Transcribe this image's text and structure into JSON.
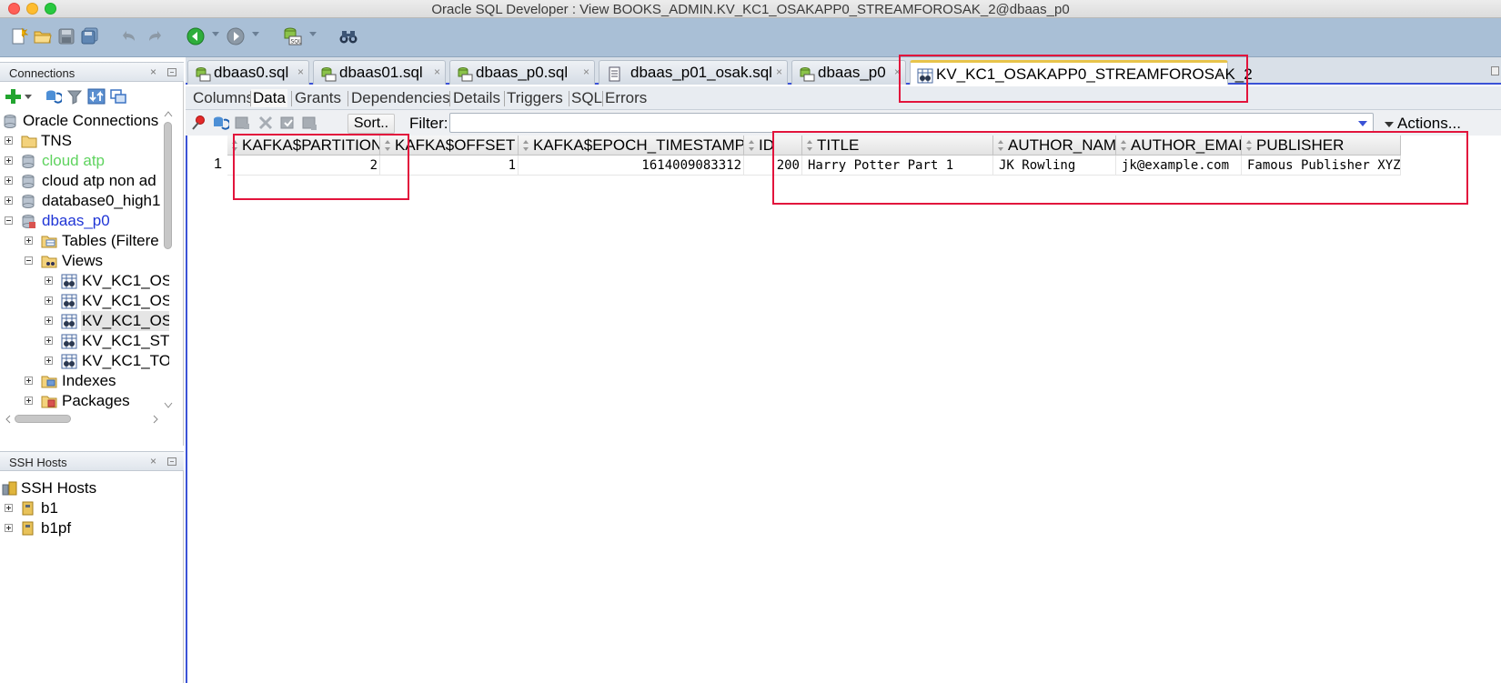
{
  "window": {
    "title": "Oracle SQL Developer : View BOOKS_ADMIN.KV_KC1_OSAKAPP0_STREAMFOROSAK_2@dbaas_p0"
  },
  "colors": {
    "toolbar_bg": "#a9bfd6",
    "accent": "#3a52d6",
    "annotation": "#e2143c",
    "green_conn": "#5fd35f",
    "blue_conn": "#1f35d6"
  },
  "connections_panel": {
    "title": "Connections",
    "close_glyph": "×",
    "tree": [
      {
        "label": "Oracle Connections",
        "icon": "database-icon"
      },
      {
        "label": "TNS",
        "icon": "folder-icon"
      },
      {
        "label": "cloud atp",
        "icon": "database-icon"
      },
      {
        "label": "cloud atp non ad",
        "icon": "database-icon"
      },
      {
        "label": "database0_high1",
        "icon": "database-icon"
      },
      {
        "label": "dbaas_p0",
        "icon": "database-icon"
      },
      {
        "label": "Tables (Filtere",
        "icon": "tables-folder-icon"
      },
      {
        "label": "Views",
        "icon": "views-folder-icon"
      },
      {
        "label": "KV_KC1_OS",
        "icon": "view-icon"
      },
      {
        "label": "KV_KC1_OS",
        "icon": "view-icon"
      },
      {
        "label": "KV_KC1_OS",
        "icon": "view-icon"
      },
      {
        "label": "KV_KC1_ST",
        "icon": "view-icon"
      },
      {
        "label": "KV_KC1_TO",
        "icon": "view-icon"
      },
      {
        "label": "Indexes",
        "icon": "indexes-folder-icon"
      },
      {
        "label": "Packages",
        "icon": "packages-folder-icon"
      }
    ]
  },
  "ssh_panel": {
    "title": "SSH Hosts",
    "close_glyph": "×",
    "tree": [
      {
        "label": "SSH Hosts",
        "icon": "ssh-hosts-icon"
      },
      {
        "label": "b1",
        "icon": "ssh-host-icon"
      },
      {
        "label": "b1pf",
        "icon": "ssh-host-icon"
      }
    ]
  },
  "editor_tabs": [
    {
      "label": "dbaas0.sql",
      "icon": "sql-worksheet-icon",
      "close": "×"
    },
    {
      "label": "dbaas01.sql",
      "icon": "sql-worksheet-icon",
      "close": "×"
    },
    {
      "label": "dbaas_p0.sql",
      "icon": "sql-worksheet-icon",
      "close": "×"
    },
    {
      "label": "dbaas_p01_osak.sql",
      "icon": "sql-file-icon",
      "close": "×"
    },
    {
      "label": "dbaas_p0",
      "icon": "sql-worksheet-icon",
      "close": "×"
    },
    {
      "label": "KV_KC1_OSAKAPP0_STREAMFOROSAK_2",
      "icon": "view-icon",
      "close": "×"
    }
  ],
  "sub_tabs": [
    "Columns",
    "Data",
    "Grants",
    "Dependencies",
    "Details",
    "Triggers",
    "SQL",
    "Errors"
  ],
  "data_toolbar": {
    "sort_label": "Sort..",
    "filter_label": "Filter:",
    "filter_value": "",
    "actions_label": "Actions..."
  },
  "grid": {
    "columns": [
      "KAFKA$PARTITION",
      "KAFKA$OFFSET",
      "KAFKA$EPOCH_TIMESTAMP",
      "ID",
      "TITLE",
      "AUTHOR_NAME",
      "AUTHOR_EMAIL",
      "PUBLISHER"
    ],
    "rows": [
      {
        "num": "1",
        "cells": [
          "2",
          "1",
          "1614009083312",
          "200",
          "Harry Potter Part 1",
          "JK Rowling",
          "jk@example.com",
          "Famous Publisher XYZ"
        ]
      }
    ]
  }
}
